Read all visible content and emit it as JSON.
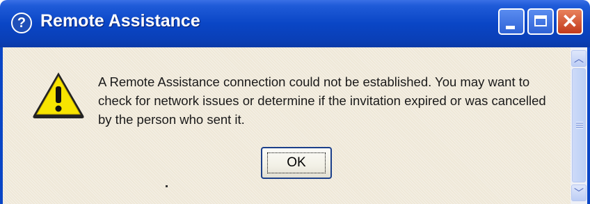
{
  "window": {
    "title": "Remote Assistance",
    "icons": {
      "title": "help-icon",
      "minimize": "minimize-icon",
      "maximize": "maximize-icon",
      "close": "close-icon"
    },
    "close_glyph": "✕"
  },
  "dialog": {
    "icon": "warning-icon",
    "message": "A Remote Assistance connection could not be established. You may want to check for network issues or determine if the invitation expired or was cancelled by the person who sent it.",
    "ok_label": "OK"
  },
  "scrollbar": {
    "up_glyph": "︿",
    "down_glyph": "﹀"
  },
  "colors": {
    "titlebar": "#0a46c6",
    "content_bg": "#efe8d8",
    "warning_yellow": "#f7e400"
  }
}
